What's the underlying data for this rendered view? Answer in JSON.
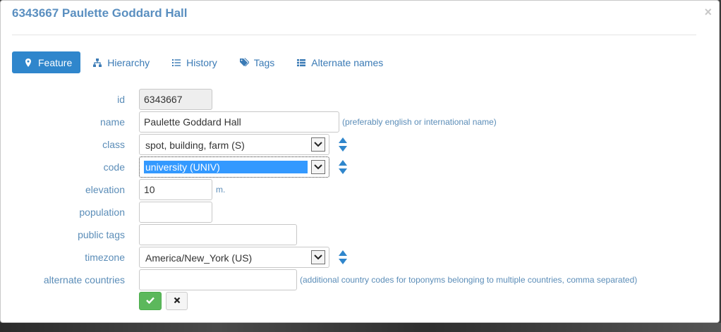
{
  "dialog": {
    "title": "6343667 Paulette Goddard Hall",
    "close_label": "×"
  },
  "tabs": [
    {
      "label": "Feature",
      "icon": "map-marker-icon",
      "active": true
    },
    {
      "label": "Hierarchy",
      "icon": "sitemap-icon",
      "active": false
    },
    {
      "label": "History",
      "icon": "list-icon",
      "active": false
    },
    {
      "label": "Tags",
      "icon": "tags-icon",
      "active": false
    },
    {
      "label": "Alternate names",
      "icon": "table-list-icon",
      "active": false
    }
  ],
  "form": {
    "id": {
      "label": "id",
      "value": "6343667"
    },
    "name": {
      "label": "name",
      "value": "Paulette Goddard Hall",
      "hint": "(preferably english or international name)"
    },
    "class": {
      "label": "class",
      "value": "spot, building, farm (S)"
    },
    "code": {
      "label": "code",
      "value": "university (UNIV)"
    },
    "elevation": {
      "label": "elevation",
      "value": "10",
      "unit": "m."
    },
    "population": {
      "label": "population",
      "value": ""
    },
    "public_tags": {
      "label": "public tags",
      "value": ""
    },
    "timezone": {
      "label": "timezone",
      "value": "America/New_York (US)"
    },
    "alternate_countries": {
      "label": "alternate countries",
      "value": "",
      "hint": "(additional country codes for toponyms belonging to multiple countries, comma separated)"
    }
  },
  "actions": {
    "save_icon": "check-icon",
    "cancel_icon": "x-icon"
  },
  "colors": {
    "accent": "#2f86cc",
    "label": "#5b8db8",
    "title": "#5a8fc0",
    "save": "#5cb85c"
  }
}
